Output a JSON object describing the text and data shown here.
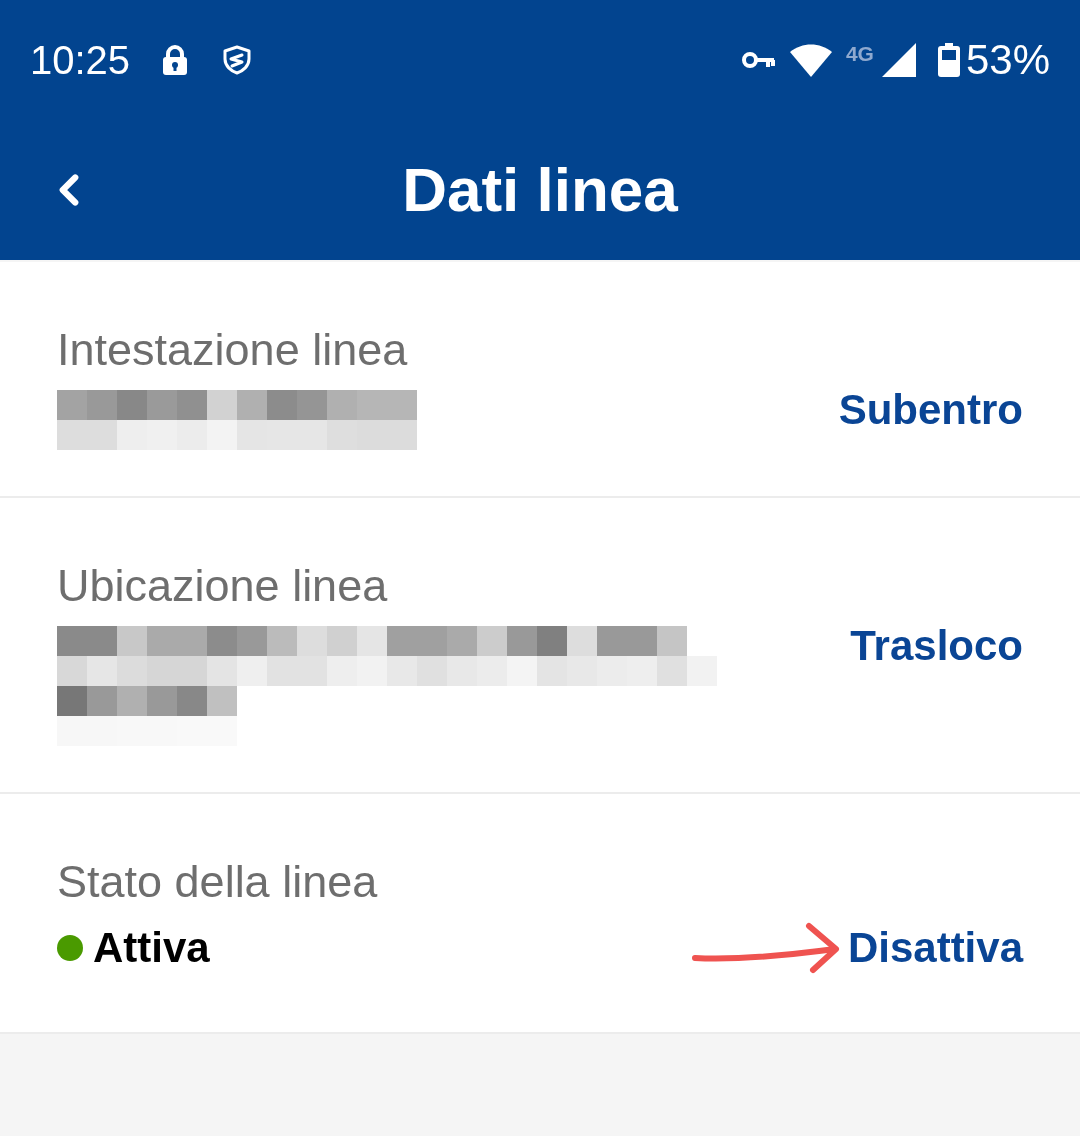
{
  "status_bar": {
    "time": "10:25",
    "network": "4G",
    "battery": "53%"
  },
  "header": {
    "title": "Dati linea"
  },
  "sections": [
    {
      "kind": "redacted",
      "label": "Intestazione linea",
      "action": "Subentro"
    },
    {
      "kind": "redacted",
      "label": "Ubicazione linea",
      "action": "Trasloco"
    },
    {
      "kind": "status",
      "label": "Stato della linea",
      "status": {
        "text": "Attiva",
        "color": "#4a9a00"
      },
      "action": "Disattiva",
      "annotation": {
        "kind": "arrow"
      }
    }
  ]
}
